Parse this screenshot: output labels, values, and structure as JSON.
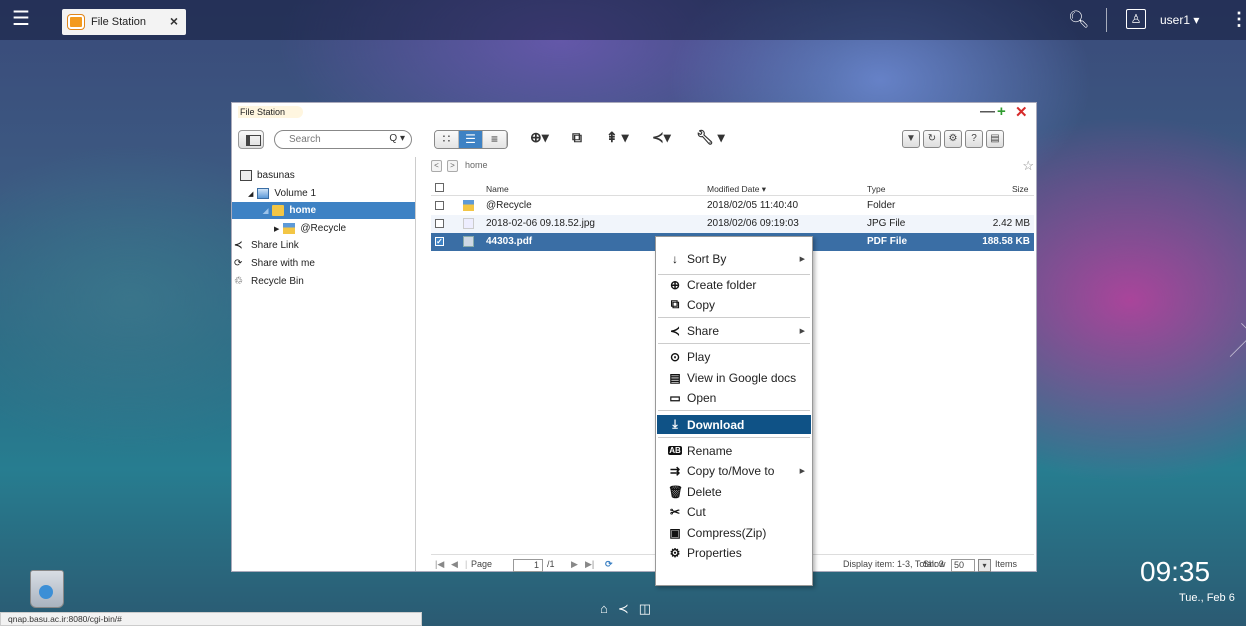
{
  "topbar": {
    "app_tab_label": "File Station",
    "user_label": "user1 ▾",
    "more_glyph": "⋮",
    "search_glyph": "⚲"
  },
  "window": {
    "title": "File Station",
    "minimize_glyph": "—",
    "maximize_glyph": "+",
    "close_glyph": "✕"
  },
  "toolbar": {
    "search_placeholder": "Search",
    "search_glyph": "Q ▾",
    "view_buttons": [
      "∷",
      "☰",
      "≡"
    ]
  },
  "sidebar": {
    "items": [
      {
        "label": "basunas"
      },
      {
        "label": "Volume 1"
      },
      {
        "label": "home"
      },
      {
        "label": "@Recycle"
      },
      {
        "label": "Share Link"
      },
      {
        "label": "Share with me"
      },
      {
        "label": "Recycle Bin"
      }
    ]
  },
  "nav": {
    "back": "<",
    "forward": ">",
    "path": "home",
    "star": "☆"
  },
  "table": {
    "headers": {
      "name": "Name",
      "modified": "Modified Date ▾",
      "type": "Type",
      "size": "Size"
    },
    "rows": [
      {
        "name": "@Recycle",
        "modified": "2018/02/05 11:40:40",
        "type": "Folder",
        "size": ""
      },
      {
        "name": "2018-02-06 09.18.52.jpg",
        "modified": "2018/02/06 09:19:03",
        "type": "JPG File",
        "size": "2.42 MB"
      },
      {
        "name": "44303.pdf",
        "modified": "",
        "type": "PDF File",
        "size": "188.58 KB"
      }
    ]
  },
  "pager": {
    "page_label": "Page",
    "page_value": "1",
    "page_total": "/1",
    "display_info": "Display item: 1-3, Total: 3",
    "show_label": "Show",
    "show_value": "50",
    "items_label": "Items"
  },
  "context_menu": {
    "items": [
      {
        "label": "Sort By",
        "icon": "sort-icon"
      },
      {
        "label": "Create folder",
        "icon": "create-folder-icon"
      },
      {
        "label": "Copy",
        "icon": "copy-icon"
      },
      {
        "label": "Share",
        "icon": "share-icon"
      },
      {
        "label": "Play",
        "icon": "play-icon"
      },
      {
        "label": "View in Google docs",
        "icon": "google-docs-icon"
      },
      {
        "label": "Open",
        "icon": "open-icon"
      },
      {
        "label": "Download",
        "icon": "download-icon"
      },
      {
        "label": "Rename",
        "icon": "rename-icon"
      },
      {
        "label": "Copy to/Move to",
        "icon": "copy-move-icon"
      },
      {
        "label": "Delete",
        "icon": "delete-icon"
      },
      {
        "label": "Cut",
        "icon": "cut-icon"
      },
      {
        "label": "Compress(Zip)",
        "icon": "compress-icon"
      },
      {
        "label": "Properties",
        "icon": "properties-icon"
      }
    ]
  },
  "desktop": {
    "clock": "09:35",
    "date": "Tue., Feb 6",
    "status_url": "qnap.basu.ac.ir:8080/cgi-bin/#"
  }
}
